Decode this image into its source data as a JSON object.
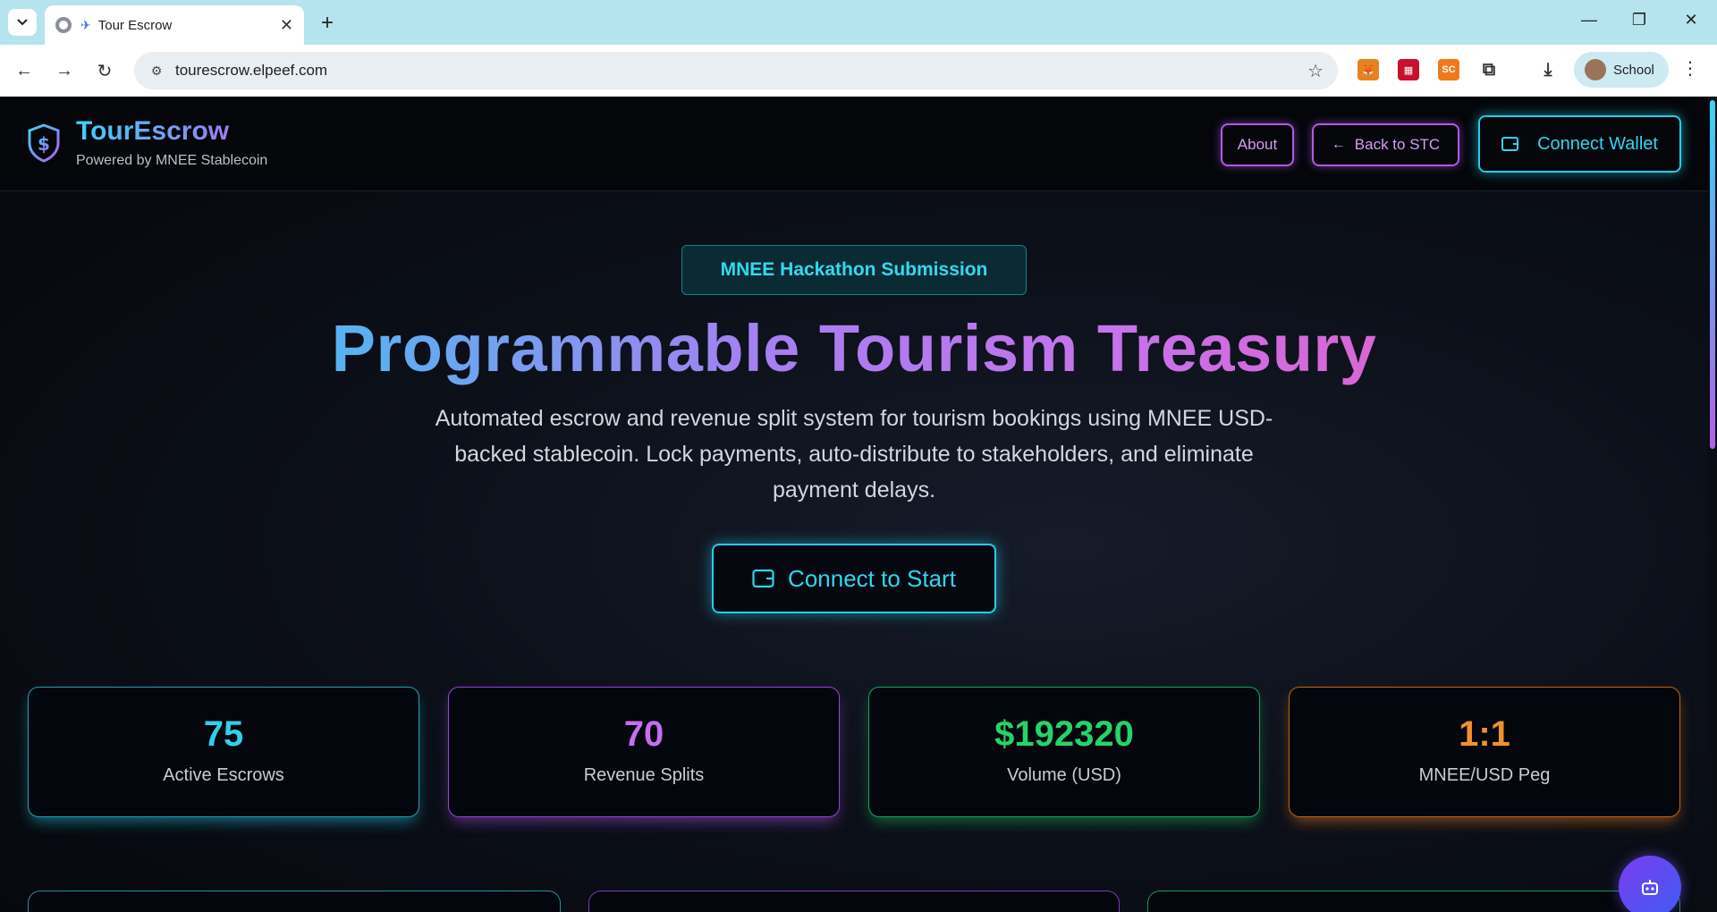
{
  "browser": {
    "tab_title": "Tour Escrow",
    "url": "tourescrow.elpeef.com",
    "profile_name": "School",
    "extensions": [
      {
        "name": "metamask-extension-icon",
        "color": "#e8821e"
      },
      {
        "name": "red-extension-icon",
        "color": "#c8102e"
      },
      {
        "name": "sc-extension-icon",
        "label": "SC",
        "color": "#f07a1a"
      },
      {
        "name": "puzzle-extension-icon",
        "color": "#444444"
      }
    ]
  },
  "header": {
    "brand": "TourEscrow",
    "subtitle": "Powered by MNEE Stablecoin",
    "about_label": "About",
    "back_label": "Back to STC",
    "connect_wallet_label": "Connect Wallet"
  },
  "hero": {
    "badge": "MNEE Hackathon Submission",
    "title": "Programmable Tourism Treasury",
    "description": "Automated escrow and revenue split system for tourism bookings using MNEE USD-backed stablecoin. Lock payments, auto-distribute to stakeholders, and eliminate payment delays.",
    "cta_label": "Connect to Start"
  },
  "stats": [
    {
      "value": "75",
      "label": "Active Escrows",
      "color": "#2fd0ec"
    },
    {
      "value": "70",
      "label": "Revenue Splits",
      "color": "#c56ff0"
    },
    {
      "value": "$192320",
      "label": "Volume (USD)",
      "color": "#25d468"
    },
    {
      "value": "1:1",
      "label": "MNEE/USD Peg",
      "color": "#f2902a"
    }
  ],
  "colors": {
    "accent_cyan": "#24cfe8",
    "accent_purple": "#b158e6",
    "background": "#05070c"
  }
}
